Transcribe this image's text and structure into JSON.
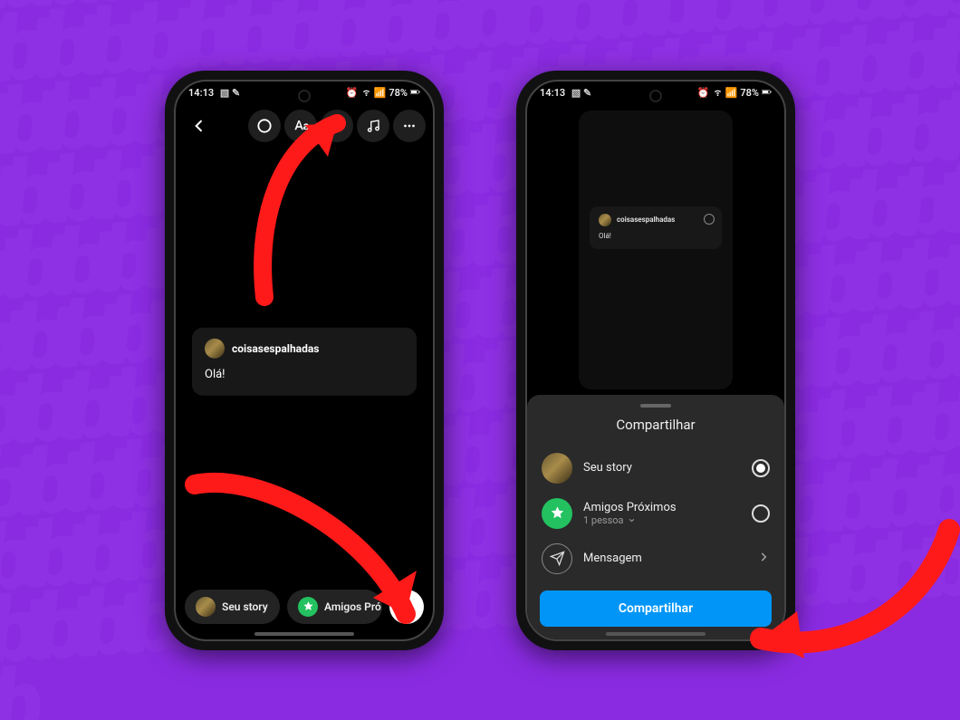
{
  "status": {
    "time": "14:13",
    "battery": "78%"
  },
  "editor": {
    "note_user": "coisasespalhadas",
    "note_text": "Olá!",
    "pill_story": "Seu story",
    "pill_close": "Amigos Pró..."
  },
  "share": {
    "preview_user": "coisasespalhadas",
    "preview_text": "Olá!",
    "sheet_title": "Compartilhar",
    "opt_story": "Seu story",
    "opt_close": "Amigos Próximos",
    "opt_close_sub": "1 pessoa",
    "opt_message": "Mensagem",
    "button": "Compartilhar"
  }
}
